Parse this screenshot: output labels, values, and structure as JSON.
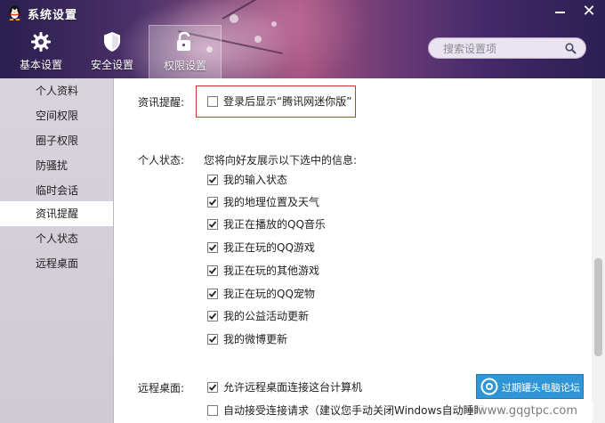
{
  "window": {
    "title": "系统设置"
  },
  "tabs": [
    {
      "label": "基本设置",
      "icon": "gear-icon"
    },
    {
      "label": "安全设置",
      "icon": "shield-icon"
    },
    {
      "label": "权限设置",
      "icon": "unlock-icon",
      "active": true
    }
  ],
  "search": {
    "placeholder": "搜索设置项"
  },
  "sidebar": {
    "items": [
      {
        "label": "个人资料"
      },
      {
        "label": "空间权限"
      },
      {
        "label": "圈子权限"
      },
      {
        "label": "防骚扰"
      },
      {
        "label": "临时会话"
      },
      {
        "label": "资讯提醒",
        "active": true
      },
      {
        "label": "个人状态"
      },
      {
        "label": "远程桌面"
      }
    ]
  },
  "content": {
    "news_reminder": {
      "label": "资讯提醒:",
      "option": {
        "label": "登录后显示“腾讯网迷你版”",
        "checked": false
      }
    },
    "status": {
      "label": "个人状态:",
      "description": "您将向好友展示以下选中的信息:",
      "options": [
        {
          "label": "我的输入状态",
          "checked": true
        },
        {
          "label": "我的地理位置及天气",
          "checked": true
        },
        {
          "label": "我正在播放的QQ音乐",
          "checked": true
        },
        {
          "label": "我正在玩的QQ游戏",
          "checked": true
        },
        {
          "label": "我正在玩的其他游戏",
          "checked": true
        },
        {
          "label": "我正在玩的QQ宠物",
          "checked": true
        },
        {
          "label": "我的公益活动更新",
          "checked": true
        },
        {
          "label": "我的微博更新",
          "checked": true
        }
      ]
    },
    "remote": {
      "label": "远程桌面:",
      "options": [
        {
          "label": "允许远程桌面连接这台计算机",
          "checked": true
        },
        {
          "label": "自动接受连接请求（建议您手动关闭Windows自动睡眠",
          "checked": false
        }
      ]
    }
  },
  "watermark": {
    "text": "过期罐头电脑论坛",
    "url": "www.gqgtpc.com"
  },
  "colors": {
    "highlight": "#d2332c",
    "watermark_bg": "#2f95d4",
    "sidebar_bg": "#d8d3dc"
  }
}
